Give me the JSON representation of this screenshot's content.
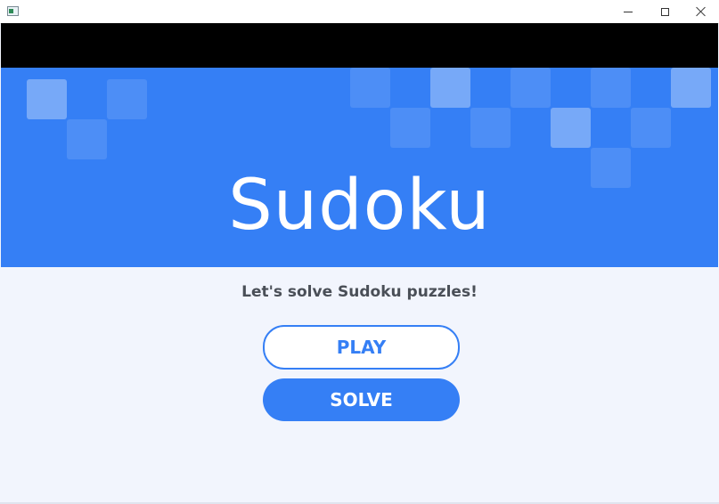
{
  "window": {
    "app_icon": "app-icon",
    "minimize_icon": "minimize-icon",
    "maximize_icon": "maximize-icon",
    "close_icon": "close-icon"
  },
  "banner": {
    "title": "Sudoku",
    "background_color": "#357ff5"
  },
  "main": {
    "subtitle": "Let's solve Sudoku puzzles!",
    "play_label": "PLAY",
    "solve_label": "SOLVE",
    "accent_color": "#357ff5"
  }
}
